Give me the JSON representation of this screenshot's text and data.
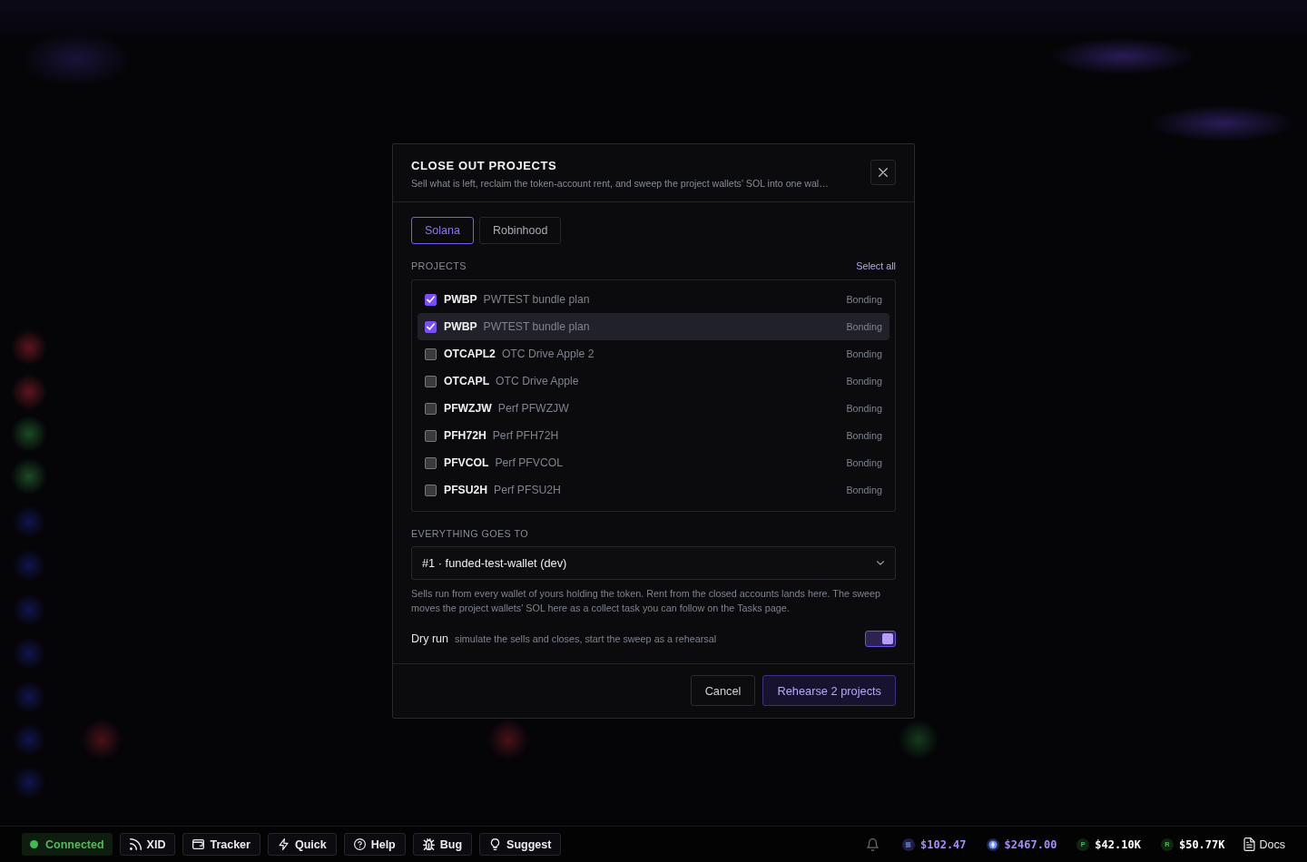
{
  "dialog": {
    "title": "CLOSE OUT PROJECTS",
    "subtitle": "Sell what is left, reclaim the token-account rent, and sweep the project wallets' SOL into one wal…",
    "tabs": [
      {
        "label": "Solana",
        "selected": true
      },
      {
        "label": "Robinhood",
        "selected": false
      }
    ],
    "projects": {
      "label": "PROJECTS",
      "select_all": "Select all",
      "rows": [
        {
          "code": "PWBP",
          "name": "PWTEST bundle plan",
          "status": "Bonding",
          "checked": true,
          "highlighted": false
        },
        {
          "code": "PWBP",
          "name": "PWTEST bundle plan",
          "status": "Bonding",
          "checked": true,
          "highlighted": true
        },
        {
          "code": "OTCAPL2",
          "name": "OTC Drive Apple 2",
          "status": "Bonding",
          "checked": false,
          "highlighted": false
        },
        {
          "code": "OTCAPL",
          "name": "OTC Drive Apple",
          "status": "Bonding",
          "checked": false,
          "highlighted": false
        },
        {
          "code": "PFWZJW",
          "name": "Perf PFWZJW",
          "status": "Bonding",
          "checked": false,
          "highlighted": false
        },
        {
          "code": "PFH72H",
          "name": "Perf PFH72H",
          "status": "Bonding",
          "checked": false,
          "highlighted": false
        },
        {
          "code": "PFVCOL",
          "name": "Perf PFVCOL",
          "status": "Bonding",
          "checked": false,
          "highlighted": false
        },
        {
          "code": "PFSU2H",
          "name": "Perf PFSU2H",
          "status": "Bonding",
          "checked": false,
          "highlighted": false
        }
      ]
    },
    "destination": {
      "label": "EVERYTHING GOES TO",
      "value": "#1 · funded-test-wallet (dev)",
      "note": "Sells run from every wallet of yours holding the token. Rent from the closed accounts lands here. The sweep moves the project wallets' SOL here as a collect task you can follow on the Tasks page."
    },
    "dry_run": {
      "label": "Dry run",
      "hint": "simulate the sells and closes, start the sweep as a rehearsal",
      "on": true
    },
    "buttons": [
      {
        "label": "Cancel",
        "kind": "secondary"
      },
      {
        "label": "Rehearse 2 projects",
        "kind": "primary"
      }
    ]
  },
  "status_bar": {
    "connection": {
      "label": "Connected",
      "connected": true
    },
    "tools": [
      {
        "label": "XID"
      },
      {
        "label": "Tracker"
      },
      {
        "label": "Quick"
      },
      {
        "label": "Help"
      },
      {
        "label": "Bug"
      },
      {
        "label": "Suggest"
      }
    ],
    "tickers": [
      {
        "kind": "coin",
        "amount": "$102.47",
        "color": "#a78bfa"
      },
      {
        "kind": "coin",
        "amount": "$2467.00",
        "color": "#a78bfa"
      },
      {
        "kind": "points",
        "badge": "P",
        "amount": "$42.10K",
        "color": "#ffffff"
      },
      {
        "kind": "points",
        "badge": "R",
        "amount": "$50.77K",
        "color": "#ffffff"
      }
    ],
    "docs": "Docs"
  }
}
